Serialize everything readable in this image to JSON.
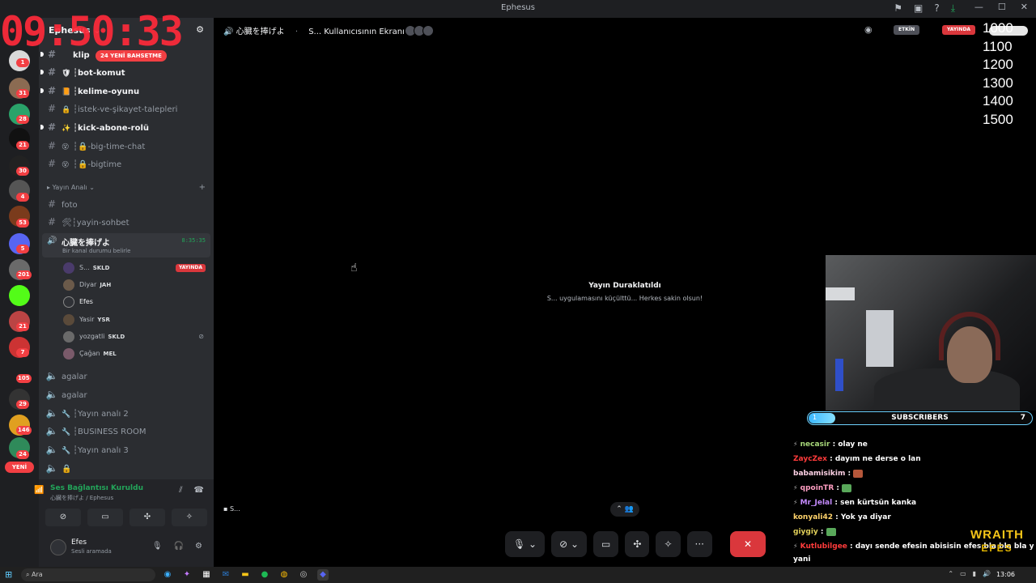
{
  "window": {
    "title": "Ephesus"
  },
  "titlebar_icons": [
    "flag-icon",
    "inbox-icon",
    "help-icon",
    "download-icon"
  ],
  "overlay": {
    "clock": "09:50:33",
    "levels": [
      "1000",
      "1100",
      "1200",
      "1300",
      "1400",
      "1500"
    ]
  },
  "rail": {
    "badges": [
      "1",
      "31",
      "28",
      "21",
      "30",
      "4",
      "53",
      "5",
      "201",
      "21",
      "7",
      "105",
      "29",
      "146",
      "24"
    ],
    "new_label": "YENİ"
  },
  "server": {
    "name": "Ephesus",
    "new_messages": "24 YENİ BAHSETME"
  },
  "channels": [
    {
      "emoji": "",
      "name": "klip"
    },
    {
      "emoji": "🛡",
      "name": "┆bot-komut"
    },
    {
      "emoji": "📙",
      "name": "┆kelime-oyunu"
    },
    {
      "emoji": "🔒",
      "name": "┆istek-ve-şikayet-talepleri"
    },
    {
      "emoji": "✨",
      "name": "┆kick-abone-rolü"
    },
    {
      "emoji": "😵",
      "name": "┆🔒-big-time-chat"
    },
    {
      "emoji": "😵",
      "name": "┆🔒-bigtime"
    }
  ],
  "category": {
    "name": "Yayın Analı",
    "channels": [
      "foto",
      "🛠┆yayin-sohbet"
    ]
  },
  "voice_channel": {
    "name": "心臓を捧げよ",
    "time": "8:35:35",
    "status": "Bir kanal durumu belirle",
    "users": [
      {
        "name": "S...",
        "tag": "SKLD",
        "live": "YAYINDA"
      },
      {
        "name": "Diyar",
        "tag": "JAH"
      },
      {
        "name": "Efes",
        "tag": ""
      },
      {
        "name": "Yasir",
        "tag": "YSR"
      },
      {
        "name": "yozgatli",
        "tag": "SKLD"
      },
      {
        "name": "Çağan",
        "tag": "MEL"
      }
    ]
  },
  "other_voice": [
    "agalar",
    "agalar",
    "┆Yayın analı 2",
    "┆BUSINESS ROOM",
    "┆Yayın analı 3",
    "🔒"
  ],
  "connection": {
    "status": "Ses Bağlantısı Kuruldu",
    "channel": "心臓を捧げよ / Ephesus"
  },
  "user": {
    "name": "Efes",
    "status": "Sesli aramada"
  },
  "stage": {
    "channel": "心臓を捧げよ",
    "screen_title": "S... Kullanıcısının Ekranı",
    "active_label": "ETKİN",
    "live_label": "YAYINDA",
    "paused_title": "Yayın Duraklatıldı",
    "paused_sub": "S... uygulamasını küçülttü... Herkes sakin olsun!",
    "sharer": "S..."
  },
  "subs": {
    "start": "1",
    "label": "SUBSCRIBERS",
    "goal": "7",
    "progress": 0.12
  },
  "chat": [
    {
      "user": "necasir",
      "color": "#a8d87a",
      "badge": true,
      "text": "olay ne"
    },
    {
      "user": "ZaycZex",
      "color": "#ff3b3b",
      "badge": false,
      "text": "dayım ne derse o lan"
    },
    {
      "user": "babamisikim",
      "color": "#ffd2e6",
      "badge": false,
      "text": "",
      "emote": "#b5573a"
    },
    {
      "user": "qpoinTR",
      "color": "#ff9ec2",
      "badge": true,
      "text": "",
      "emote": "#59a85a"
    },
    {
      "user": "Mr_Jelal",
      "color": "#c58bff",
      "badge": true,
      "text": "sen kürtsün kanka"
    },
    {
      "user": "konyali42",
      "color": "#ffd36b",
      "badge": false,
      "text": "Yok ya diyar"
    },
    {
      "user": "giygiy",
      "color": "#e1d05a",
      "badge": false,
      "text": "",
      "emote": "#59a85a"
    },
    {
      "user": "Kutlubilgee",
      "color": "#ff3b3b",
      "badge": true,
      "text": "dayı sende efesin abisisin efes bla bla bla y"
    }
  ],
  "chat_continuation": "yani",
  "logo": {
    "line1": "WRAITH",
    "line2": "EFES"
  },
  "taskbar": {
    "search": "Ara",
    "time": "13:06"
  }
}
